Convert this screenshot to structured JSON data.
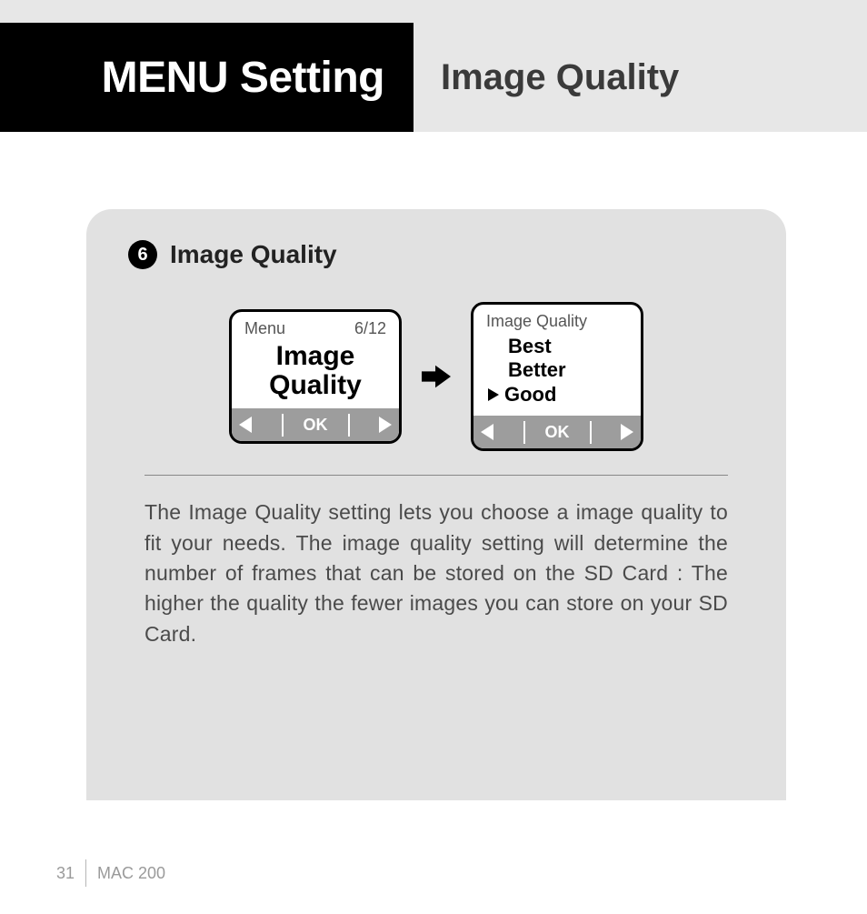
{
  "header": {
    "left_title": "MENU Setting",
    "right_title": "Image Quality"
  },
  "section": {
    "number": "6",
    "title": "Image Quality"
  },
  "screens": {
    "menu": {
      "label": "Menu",
      "page": "6/12",
      "item_line1": "Image",
      "item_line2": "Quality",
      "ok": "OK"
    },
    "quality": {
      "title": "Image Quality",
      "options": [
        "Best",
        "Better",
        "Good"
      ],
      "selected_index": 2,
      "ok": "OK"
    }
  },
  "body": {
    "text": "The Image Quality setting lets you choose a image quality to fit your needs.  The image quality setting will determine the number of frames that can be stored on the SD Card :  The higher the quality the fewer images you can store on your SD Card."
  },
  "footer": {
    "page_number": "31",
    "model": "MAC 200"
  }
}
